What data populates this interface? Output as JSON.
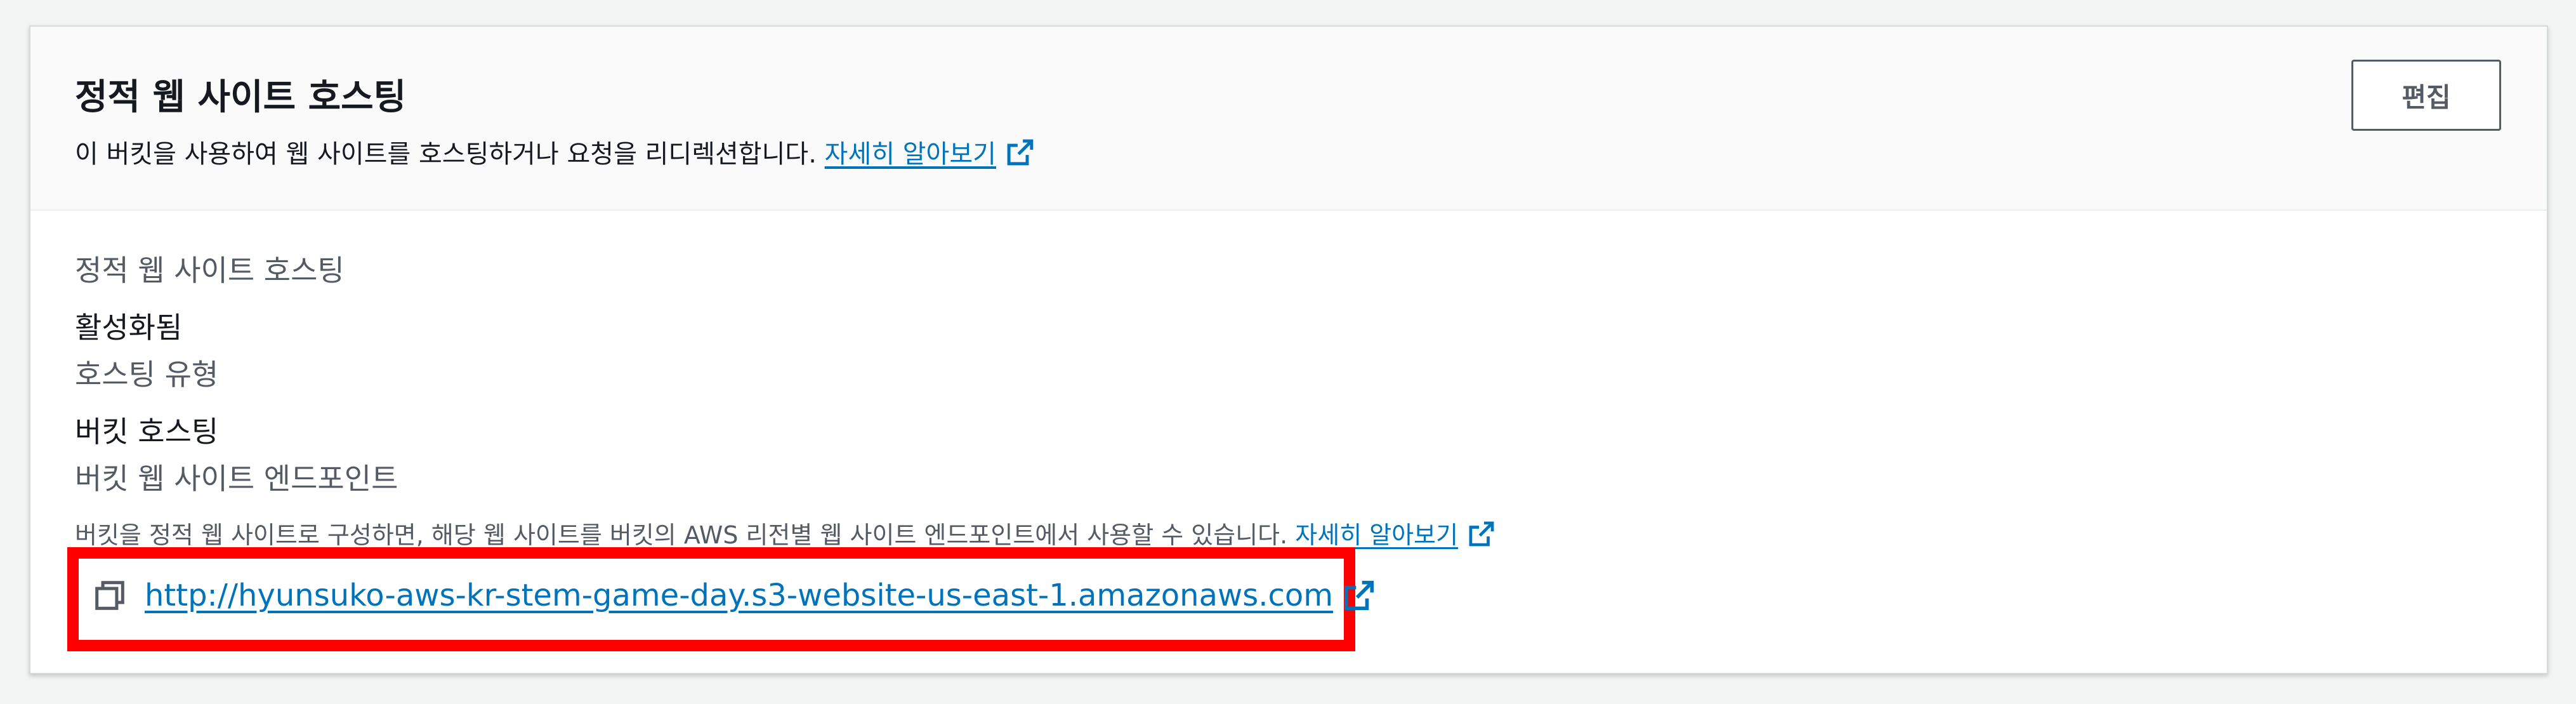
{
  "panel": {
    "title": "정적 웹 사이트 호스팅",
    "subtitle": "이 버킷을 사용하여 웹 사이트를 호스팅하거나 요청을 리디렉션합니다.",
    "learn_more": "자세히 알아보기",
    "edit_button": "편집"
  },
  "fields": {
    "static_hosting_label": "정적 웹 사이트 호스팅",
    "static_hosting_value": "활성화됨",
    "hosting_type_label": "호스팅 유형",
    "hosting_type_value": "버킷 호스팅",
    "endpoint_label": "버킷 웹 사이트 엔드포인트",
    "endpoint_description": "버킷을 정적 웹 사이트로 구성하면, 해당 웹 사이트를 버킷의 AWS 리전별 웹 사이트 엔드포인트에서 사용할 수 있습니다.",
    "endpoint_learn_more": "자세히 알아보기",
    "endpoint_url": "http://hyunsuko-aws-kr-stem-game-day.s3-website-us-east-1.amazonaws.com"
  },
  "colors": {
    "link": "#0073bb",
    "highlight": "#ff0000"
  },
  "icons": {
    "external": "external-link-icon",
    "copy": "copy-icon"
  }
}
